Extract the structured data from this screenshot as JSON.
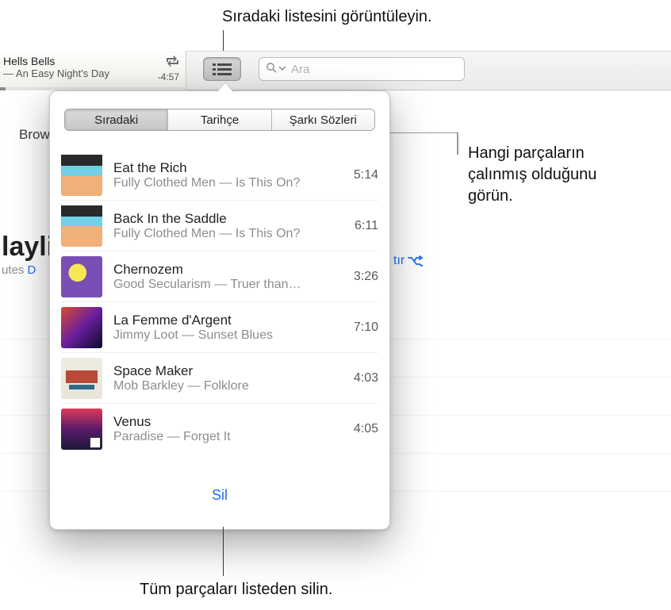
{
  "annotations": {
    "top": "Sıradaki listesini görüntüleyin.",
    "right_line1": "Hangi parçaların",
    "right_line2": "çalınmış olduğunu",
    "right_line3": "görün.",
    "bottom": "Tüm parçaları listeden silin."
  },
  "now_playing": {
    "song": "Hells Bells",
    "album_line": "— An Easy Night's Day",
    "time_remaining": "-4:57"
  },
  "search": {
    "placeholder": "Ara"
  },
  "background": {
    "browse": "Brow",
    "playlist_heading": "layli",
    "meta_prefix": "utes",
    "download": "D",
    "shuffle_fragment": "tır"
  },
  "popover": {
    "tabs": {
      "up_next": "Sıradaki",
      "history": "Tarihçe",
      "lyrics": "Şarkı Sözleri"
    },
    "clear_label": "Sil",
    "tracks": [
      {
        "title": "Eat the Rich",
        "subtitle": "Fully Clothed Men — Is This On?",
        "duration": "5:14",
        "art": "art1"
      },
      {
        "title": "Back In the Saddle",
        "subtitle": "Fully Clothed Men — Is This On?",
        "duration": "6:11",
        "art": "art1"
      },
      {
        "title": "Chernozem",
        "subtitle": "Good Secularism — Truer than…",
        "duration": "3:26",
        "art": "art3"
      },
      {
        "title": "La Femme d'Argent",
        "subtitle": "Jimmy Loot — Sunset Blues",
        "duration": "7:10",
        "art": "art4"
      },
      {
        "title": "Space Maker",
        "subtitle": "Mob Barkley — Folklore",
        "duration": "4:03",
        "art": "art5"
      },
      {
        "title": "Venus",
        "subtitle": "Paradise — Forget It",
        "duration": "4:05",
        "art": "art6"
      }
    ]
  }
}
